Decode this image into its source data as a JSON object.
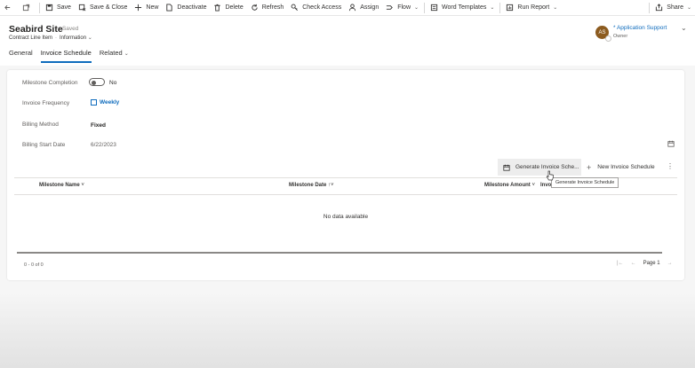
{
  "command_bar": {
    "save": "Save",
    "save_close": "Save & Close",
    "new": "New",
    "deactivate": "Deactivate",
    "delete": "Delete",
    "refresh": "Refresh",
    "check_access": "Check Access",
    "assign": "Assign",
    "flow": "Flow",
    "word_templates": "Word Templates",
    "run_report": "Run Report",
    "share": "Share"
  },
  "header": {
    "title": "Seabird Site",
    "saved_status": "- Saved",
    "entity": "Contract Line Item",
    "form": "Information",
    "owner_initials": "AS",
    "owner_name": "* Application Support",
    "owner_role": "Owner"
  },
  "tabs": [
    "General",
    "Invoice Schedule",
    "Related"
  ],
  "fields": {
    "milestone_completion": {
      "label": "Milestone Completion",
      "value": "No"
    },
    "invoice_frequency": {
      "label": "Invoice Frequency",
      "value": "Weekly"
    },
    "billing_method": {
      "label": "Billing Method",
      "value": "Fixed"
    },
    "billing_start_date": {
      "label": "Billing Start Date",
      "value": "6/22/2023"
    }
  },
  "subgrid": {
    "generate_button": "Generate Invoice Sche...",
    "new_button": "New Invoice Schedule",
    "tooltip": "Generate Invoice Schedule",
    "columns": [
      "Milestone Name",
      "Milestone Date",
      "Milestone Amount",
      "Invo"
    ],
    "empty_message": "No data available",
    "count": "0 - 0 of 0",
    "page": "Page 1"
  },
  "colors": {
    "accent": "#0f6cbd",
    "avatar": "#8c5b1f"
  }
}
